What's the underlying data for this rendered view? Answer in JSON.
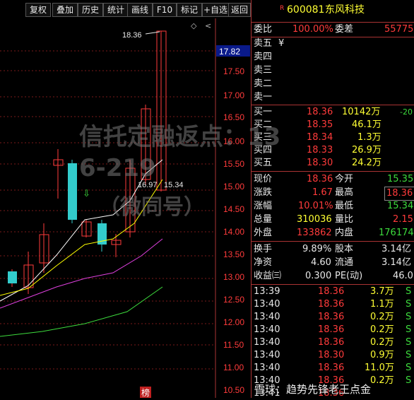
{
  "toolbar": {
    "buttons": [
      "复权",
      "叠加",
      "历史",
      "统计",
      "画线",
      "F10",
      "标记",
      "+自选",
      "返回"
    ]
  },
  "chart": {
    "top_label": "18.36",
    "ma_label_a": "16.97",
    "ma_label_b": "15.34",
    "price_current": "17.82",
    "bottom_tag": "榜",
    "axis_ticks": [
      "17.50",
      "17.00",
      "16.50",
      "16.00",
      "15.50",
      "15.00",
      "14.50",
      "14.00",
      "13.50",
      "13.00",
      "12.50",
      "12.00",
      "11.50",
      "11.00",
      "10.50"
    ]
  },
  "header": {
    "code": "600081",
    "name": "东风科技",
    "r_mark": "R"
  },
  "order": {
    "weibi_label": "委比",
    "weibi_value": "100.00%",
    "weicha_label": "委差",
    "weicha_value": "55775",
    "sells": [
      {
        "label": "卖五",
        "price": "¥",
        "vol": ""
      },
      {
        "label": "卖四",
        "price": "",
        "vol": ""
      },
      {
        "label": "卖三",
        "price": "",
        "vol": ""
      },
      {
        "label": "卖二",
        "price": "",
        "vol": ""
      },
      {
        "label": "卖一",
        "price": "",
        "vol": ""
      }
    ],
    "buys": [
      {
        "label": "买一",
        "price": "18.36",
        "vol": "10142万",
        "chg": "-20"
      },
      {
        "label": "买二",
        "price": "18.35",
        "vol": "46.1万",
        "chg": ""
      },
      {
        "label": "买三",
        "price": "18.34",
        "vol": "1.3万",
        "chg": ""
      },
      {
        "label": "买四",
        "price": "18.33",
        "vol": "26.9万",
        "chg": ""
      },
      {
        "label": "买五",
        "price": "18.30",
        "vol": "24.2万",
        "chg": ""
      }
    ]
  },
  "quote": {
    "rows": [
      {
        "l1": "现价",
        "v1": "18.36",
        "l2": "今开",
        "v2": "15.35",
        "c1": "red",
        "c2": "green"
      },
      {
        "l1": "涨跌",
        "v1": "1.67",
        "l2": "最高",
        "v2": "18.36",
        "c1": "red",
        "c2": "red"
      },
      {
        "l1": "涨幅",
        "v1": "10.01%",
        "l2": "最低",
        "v2": "15.34",
        "c1": "red",
        "c2": "green"
      },
      {
        "l1": "总量",
        "v1": "310036",
        "l2": "量比",
        "v2": "2.15",
        "c1": "yellow",
        "c2": "red"
      },
      {
        "l1": "外盘",
        "v1": "133862",
        "l2": "内盘",
        "v2": "176174",
        "c1": "red",
        "c2": "green"
      }
    ],
    "rows2": [
      {
        "l1": "换手",
        "v1": "9.89%",
        "l2": "股本",
        "v2": "3.14亿"
      },
      {
        "l1": "净资",
        "v1": "4.60",
        "l2": "流通",
        "v2": "3.14亿"
      },
      {
        "l1": "收益㈢",
        "v1": "0.300",
        "l2": "PE(动)",
        "v2": "46.0"
      }
    ]
  },
  "ticks": [
    {
      "time": "13:39",
      "price": "18.36",
      "vol": "3.7万",
      "flag": "S"
    },
    {
      "time": "13:40",
      "price": "18.36",
      "vol": "1.1万",
      "flag": "S"
    },
    {
      "time": "13:40",
      "price": "18.36",
      "vol": "0.2万",
      "flag": "S"
    },
    {
      "time": "13:40",
      "price": "18.36",
      "vol": "0.2万",
      "flag": "S"
    },
    {
      "time": "13:40",
      "price": "18.36",
      "vol": "0.2万",
      "flag": "S"
    },
    {
      "time": "13:40",
      "price": "18.30",
      "vol": "0.9万",
      "flag": "S"
    },
    {
      "time": "13:40",
      "price": "18.36",
      "vol": "11.0万",
      "flag": "S"
    },
    {
      "time": "13:40",
      "price": "18.36",
      "vol": "0.2万",
      "flag": "S"
    },
    {
      "time": "13:41",
      "price": "18.36",
      "vol": "",
      "flag": ""
    }
  ],
  "watermark": {
    "line1": "信托定融返点：13",
    "line2": "6-219",
    "line3": "（微同号）",
    "footer": "雪球：趋势先锋老王点金"
  },
  "colors": {
    "up": "#ff3b3b",
    "down": "#3ddc3d",
    "price": "#ffff33",
    "border": "#aa3333"
  }
}
